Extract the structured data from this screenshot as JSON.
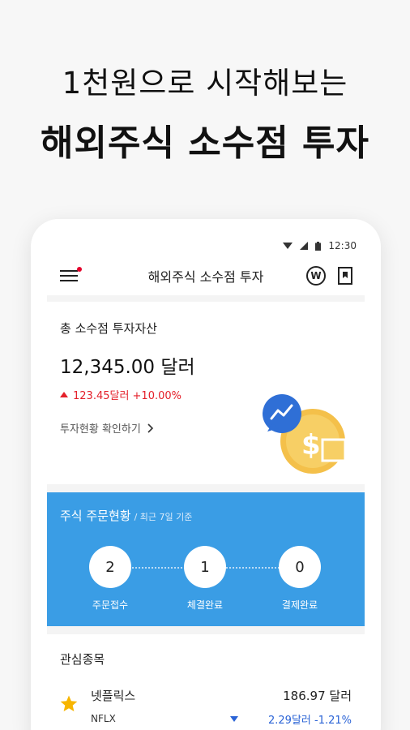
{
  "promo": {
    "line1": "1천원으로 시작해보는",
    "line2": "해외주식 소수점 투자"
  },
  "statusbar": {
    "time": "12:30"
  },
  "appbar": {
    "title": "해외주식 소수점 투자",
    "currency_label": "W"
  },
  "asset": {
    "label": "총 소수점 투자자산",
    "amount": "12,345.00 달러",
    "change": "123.45달러 +10.00%",
    "link": "투자현황 확인하기"
  },
  "orders": {
    "title": "주식 주문현황",
    "subtitle": "/ 최근 7일 기준",
    "steps": [
      {
        "count": "2",
        "label": "주문접수"
      },
      {
        "count": "1",
        "label": "체결완료"
      },
      {
        "count": "0",
        "label": "결제완료"
      }
    ]
  },
  "watchlist": {
    "title": "관심종목",
    "items": [
      {
        "name": "넷플릭스",
        "ticker": "NFLX",
        "price": "186.97 달러",
        "change": "2.29달러 -1.21%"
      }
    ]
  },
  "colors": {
    "accent_blue": "#3a9de5",
    "up_red": "#e4202a",
    "down_blue": "#2a63d6",
    "notify_dot": "#e4002b",
    "star": "#f7b500"
  }
}
